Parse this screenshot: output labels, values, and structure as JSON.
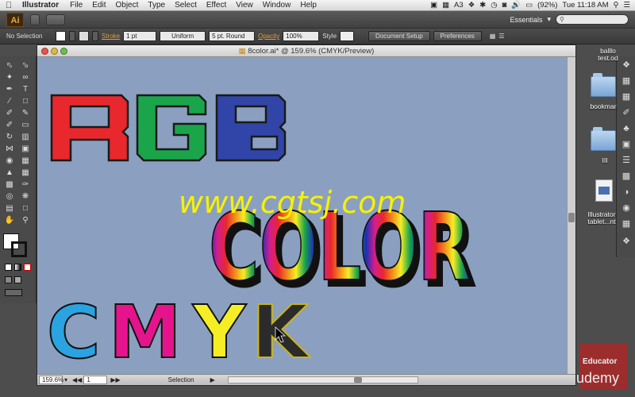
{
  "menubar": {
    "app_name": "Illustrator",
    "items": [
      "File",
      "Edit",
      "Object",
      "Type",
      "Select",
      "Effect",
      "View",
      "Window",
      "Help"
    ],
    "battery": "(92%)",
    "clock": "Tue 11:18 AM",
    "badge_a": "3"
  },
  "appbar": {
    "logo": "Ai",
    "workspace": "Essentials",
    "search_placeholder": ""
  },
  "controlbar": {
    "selection": "No Selection",
    "stroke_label": "Stroke",
    "stroke_weight": "1 pt",
    "profile": "Uniform",
    "brush": "5 pt. Round",
    "opacity_label": "Opacity",
    "opacity_value": "100%",
    "style_label": "Style",
    "document_setup": "Document Setup",
    "preferences": "Preferences"
  },
  "document": {
    "title": "8color.ai* @ 159.6% (CMYK/Preview)",
    "zoom": "159.6%",
    "artboard": "1",
    "status": "Selection"
  },
  "artwork": {
    "rgb": [
      "R",
      "G",
      "B"
    ],
    "rgb_colors": [
      "#e8282c",
      "#1ba54a",
      "#3045a7"
    ],
    "color_word": "COLOR",
    "cmyk": [
      "C",
      "M",
      "Y",
      "K"
    ],
    "cmyk_colors": [
      "#2aa3e0",
      "#e6148c",
      "#f5ee24",
      "#2b2b2b"
    ],
    "watermark": "www.cgtsj.com",
    "watermark_color": "#f6f200",
    "canvas_bg": "#8ba0c0"
  },
  "desktop": {
    "items": [
      "balllo test.od",
      "bookmar",
      "III",
      "Illustrator tablet...nt"
    ]
  },
  "brand": {
    "educator": "Educator",
    "udemy": "udemy"
  }
}
